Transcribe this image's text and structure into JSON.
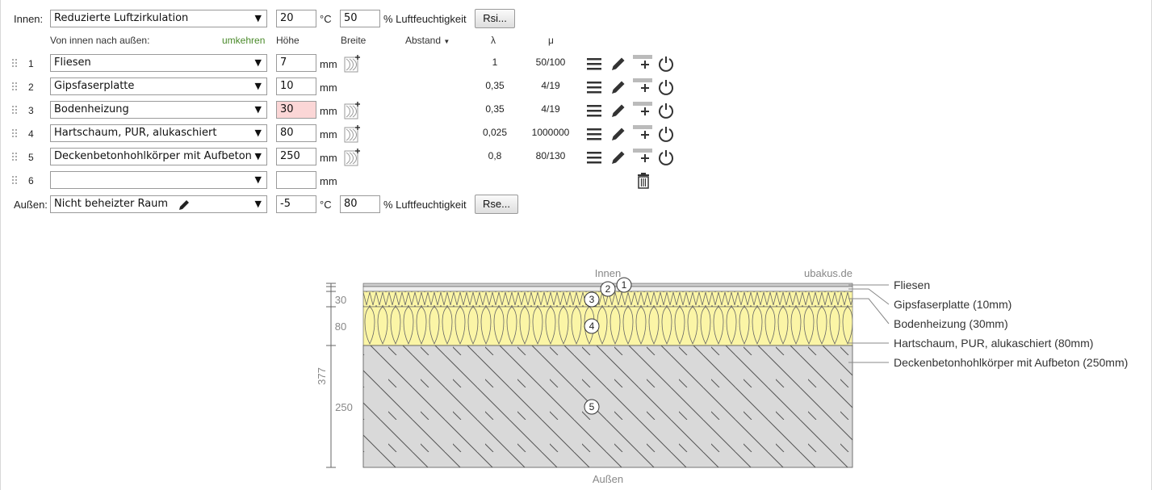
{
  "inside": {
    "label": "Innen:",
    "climate": "Reduzierte Luftzirkulation",
    "temp": "20",
    "temp_unit": "°C",
    "humidity": "50",
    "humidity_label": "% Luftfeuchtigkeit",
    "rsi_button": "Rsi..."
  },
  "headers": {
    "direction": "Von innen nach außen:",
    "reverse": "umkehren",
    "height": "Höhe",
    "width": "Breite",
    "distance": "Abstand",
    "lambda": "λ",
    "mu": "μ"
  },
  "layers": [
    {
      "index": "1",
      "material": "Fliesen",
      "thickness": "7",
      "unit": "mm",
      "lambda": "1",
      "mu": "50/100",
      "warn": false
    },
    {
      "index": "2",
      "material": "Gipsfaserplatte",
      "thickness": "10",
      "unit": "mm",
      "lambda": "0,35",
      "mu": "4/19",
      "warn": false
    },
    {
      "index": "3",
      "material": "Bodenheizung",
      "thickness": "30",
      "unit": "mm",
      "lambda": "0,35",
      "mu": "4/19",
      "warn": true
    },
    {
      "index": "4",
      "material": "Hartschaum, PUR, alukaschiert",
      "thickness": "80",
      "unit": "mm",
      "lambda": "0,025",
      "mu": "1000000",
      "warn": false
    },
    {
      "index": "5",
      "material": "Deckenbetonhohlkörper mit Aufbeton",
      "thickness": "250",
      "unit": "mm",
      "lambda": "0,8",
      "mu": "80/130",
      "warn": false
    },
    {
      "index": "6",
      "material": "",
      "thickness": "",
      "unit": "mm",
      "lambda": "",
      "mu": "",
      "warn": false
    }
  ],
  "outside": {
    "label": "Außen:",
    "climate": "Nicht beheizter Raum",
    "temp": "-5",
    "temp_unit": "°C",
    "humidity": "80",
    "humidity_label": "% Luftfeuchtigkeit",
    "rse_button": "Rse..."
  },
  "diagram": {
    "top_label": "Innen",
    "bottom_label": "Außen",
    "watermark": "ubakus.de",
    "total": "377",
    "dim_30": "30",
    "dim_80": "80",
    "dim_250": "250",
    "legend": [
      "Fliesen",
      "Gipsfaserplatte (10mm)",
      "Bodenheizung (30mm)",
      "Hartschaum, PUR, alukaschiert (80mm)",
      "Deckenbetonhohlkörper mit Aufbeton (250mm)"
    ],
    "markers": [
      "1",
      "2",
      "3",
      "4",
      "5"
    ],
    "colors": {
      "insulation": "#fbf5a6",
      "concrete": "#d9d9d9",
      "outline": "#555555"
    }
  }
}
